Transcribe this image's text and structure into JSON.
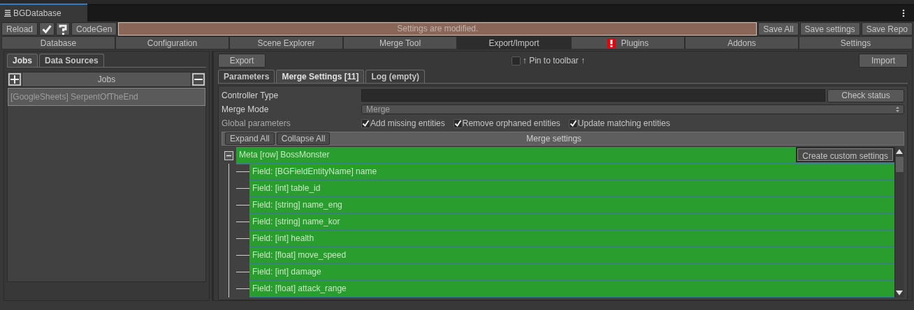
{
  "window": {
    "title": "BGDatabase"
  },
  "toolbar": {
    "buttons_left": [
      {
        "kind": "text",
        "label": "Reload"
      },
      {
        "kind": "check-icon"
      },
      {
        "kind": "help-icon"
      },
      {
        "kind": "text",
        "label": "CodeGen"
      }
    ],
    "status": "Settings are modified.",
    "buttons_right": [
      "Save All",
      "Save settings",
      "Save Repo"
    ]
  },
  "main_tabs": [
    {
      "label": "Database",
      "selected": false,
      "alert": false
    },
    {
      "label": "Configuration",
      "selected": false,
      "alert": false
    },
    {
      "label": "Scene Explorer",
      "selected": false,
      "alert": false
    },
    {
      "label": "Merge Tool",
      "selected": false,
      "alert": false
    },
    {
      "label": "Export/Import",
      "selected": true,
      "alert": false
    },
    {
      "label": "Plugins",
      "selected": false,
      "alert": true
    },
    {
      "label": "Addons",
      "selected": false,
      "alert": false
    },
    {
      "label": "Settings",
      "selected": false,
      "alert": false
    }
  ],
  "left_panel": {
    "tabs": [
      {
        "label": "Jobs",
        "selected": true
      },
      {
        "label": "Data Sources",
        "selected": false
      }
    ],
    "header": "Jobs",
    "jobs": [
      {
        "label": "[GoogleSheets] SerpentOfTheEnd",
        "selected": true
      }
    ]
  },
  "right_panel": {
    "export_button": "Export",
    "pin": {
      "label": "↑ Pin to toolbar ↑",
      "checked": false
    },
    "import_button": "Import",
    "tabs": [
      {
        "label": "Parameters",
        "selected": false
      },
      {
        "label": "Merge Settings [11]",
        "selected": true
      },
      {
        "label": "Log (empty)",
        "selected": false
      }
    ],
    "controller_type": {
      "label": "Controller Type",
      "button": "Check status"
    },
    "merge_mode": {
      "label": "Merge Mode",
      "value": "Merge"
    },
    "global_parameters": {
      "label": "Global parameters",
      "options": [
        {
          "label": "Add missing entities",
          "checked": true
        },
        {
          "label": "Remove orphaned entities",
          "checked": true
        },
        {
          "label": "Update matching entities",
          "checked": true
        }
      ]
    },
    "merge_settings": {
      "buttons": [
        "Expand All",
        "Collapse All"
      ],
      "title": "Merge settings",
      "tree": [
        {
          "label": "Meta [row] BossMonster",
          "expanded": true,
          "action": "Create custom settings",
          "children": [
            {
              "label": "Field: [BGFieldEntityName] name"
            },
            {
              "label": "Field: [int] table_id"
            },
            {
              "label": "Field: [string] name_eng"
            },
            {
              "label": "Field: [string] name_kor"
            },
            {
              "label": "Field: [int] health"
            },
            {
              "label": "Field: [float] move_speed"
            },
            {
              "label": "Field: [int] damage"
            },
            {
              "label": "Field: [float] attack_range"
            }
          ]
        }
      ]
    }
  }
}
